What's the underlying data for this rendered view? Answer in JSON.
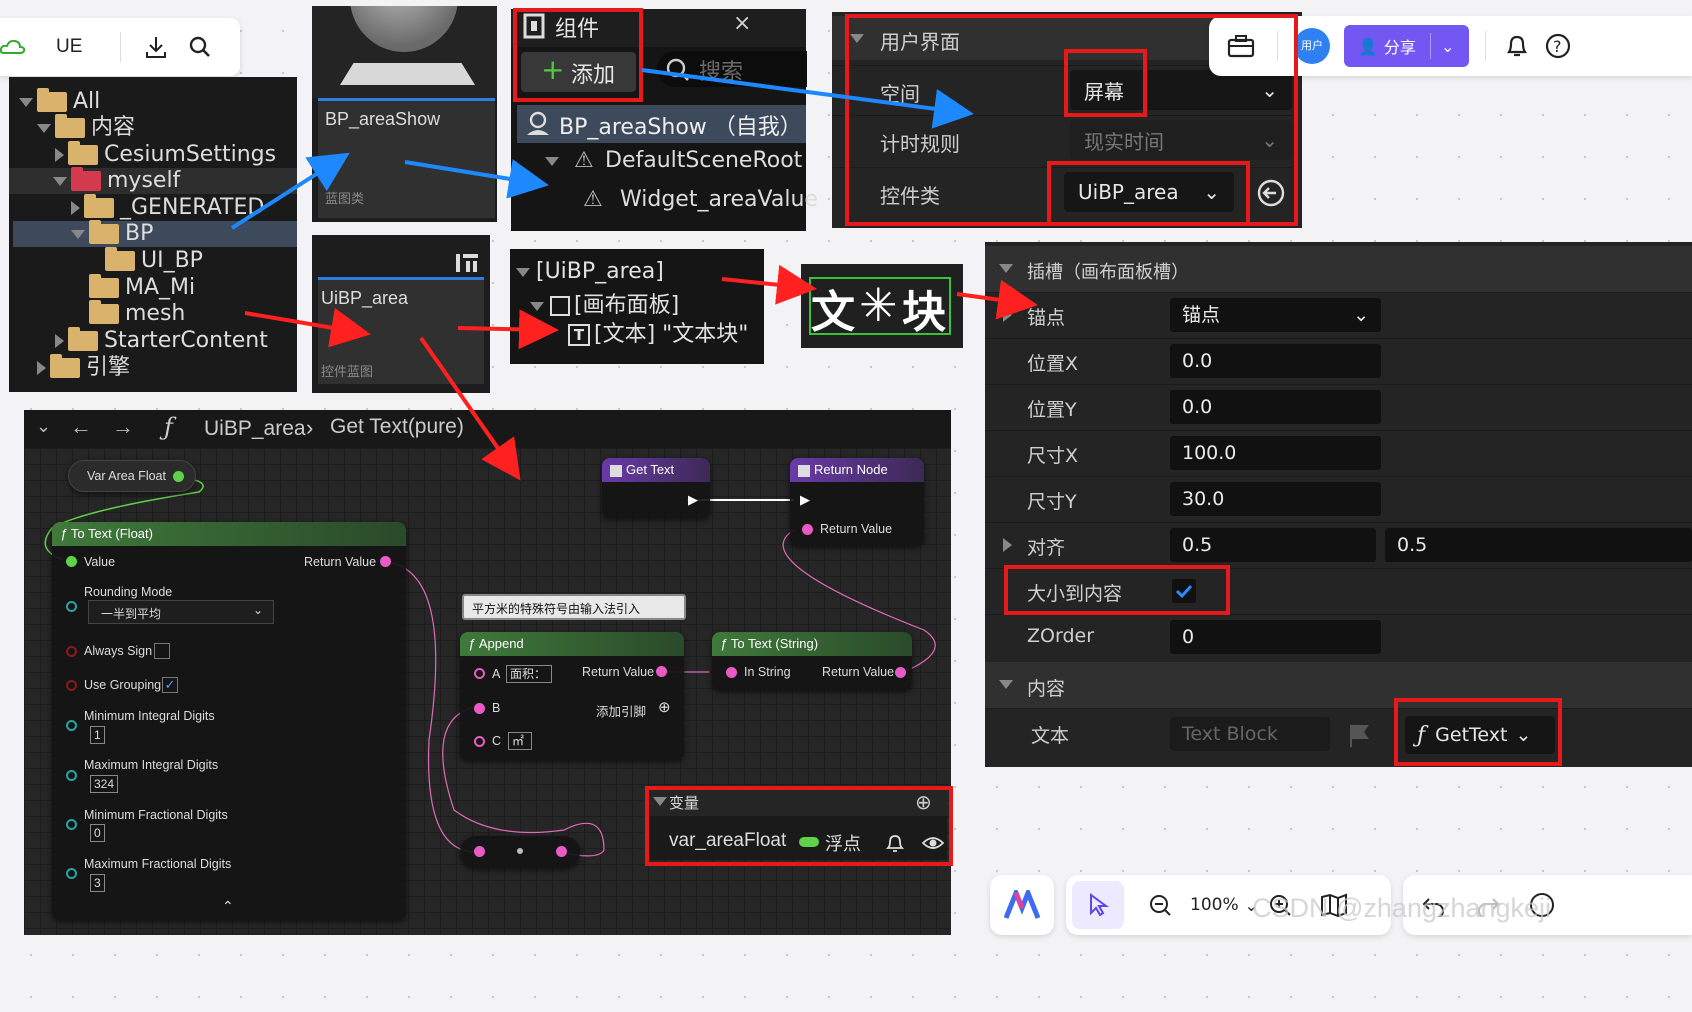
{
  "top_left_toolbar": {
    "ue_label": "UE"
  },
  "content_browser": {
    "items": [
      {
        "label": "All"
      },
      {
        "label": "内容"
      },
      {
        "label": "CesiumSettings"
      },
      {
        "label": "myself"
      },
      {
        "label": "_GENERATED"
      },
      {
        "label": "BP"
      },
      {
        "label": "UI_BP"
      },
      {
        "label": "MA_Mi"
      },
      {
        "label": "mesh"
      },
      {
        "label": "StarterContent"
      },
      {
        "label": "引擎"
      }
    ]
  },
  "asset_bp_areashow": {
    "name": "BP_areaShow",
    "type": "蓝图类"
  },
  "asset_uibp_area": {
    "name": "UiBP_area",
    "type": "控件蓝图"
  },
  "components_panel": {
    "title": "组件",
    "add_label": "添加",
    "search_placeholder": "搜索",
    "items": [
      "BP_areaShow （自我）",
      "DefaultSceneRoot",
      "Widget_areaValue"
    ]
  },
  "user_interface": {
    "title": "用户界面",
    "rows": [
      {
        "label": "空间",
        "value": "屏幕"
      },
      {
        "label": "计时规则",
        "value": "现实时间"
      },
      {
        "label": "控件类",
        "value": "UiBP_area"
      }
    ]
  },
  "top_right_toolbar": {
    "user_label": "用户",
    "share_label": "分享"
  },
  "hierarchy": {
    "root": "[UiBP_area]",
    "canvas": "[画布面板]",
    "text": "[文本] \"文本块\""
  },
  "text_preview": {
    "text_left": "文",
    "text_right": "块"
  },
  "details": {
    "slot_header": "插槽（画布面板槽）",
    "anchor_label": "锚点",
    "anchor_value": "锚点",
    "pos_x_label": "位置X",
    "pos_x_value": "0.0",
    "pos_y_label": "位置Y",
    "pos_y_value": "0.0",
    "size_x_label": "尺寸X",
    "size_x_value": "100.0",
    "size_y_label": "尺寸Y",
    "size_y_value": "30.0",
    "align_label": "对齐",
    "align_x": "0.5",
    "align_y": "0.5",
    "size_to_content_label": "大小到内容",
    "size_to_content_checked": true,
    "zorder_label": "ZOrder",
    "zorder_value": "0",
    "content_header": "内容",
    "text_label": "文本",
    "text_placeholder": "Text Block",
    "binding_label": "GetText"
  },
  "graph": {
    "breadcrumb_class": "UiBP_area",
    "breadcrumb_func": "Get Text(pure)",
    "var_node": "Var Area Float",
    "to_text_float": {
      "title": "To Text (Float)",
      "value_label": "Value",
      "return_label": "Return Value",
      "rounding_label": "Rounding Mode",
      "rounding_value": "一半到平均",
      "always_sign": "Always Sign",
      "use_grouping": "Use Grouping",
      "min_int_label": "Minimum Integral Digits",
      "min_int": "1",
      "max_int_label": "Maximum Integral Digits",
      "max_int": "324",
      "min_frac_label": "Minimum Fractional Digits",
      "min_frac": "0",
      "max_frac_label": "Maximum Fractional Digits",
      "max_frac": "3"
    },
    "get_text": "Get Text",
    "return_node": {
      "title": "Return Node",
      "pin": "Return Value"
    },
    "comment": "平方米的特殊符号由输入法引入",
    "append": {
      "title": "Append",
      "a": "A",
      "a_value": "面积：",
      "b": "B",
      "c": "C",
      "c_value": "㎡",
      "return": "Return Value",
      "add_pin": "添加引脚"
    },
    "to_text_string": {
      "title": "To Text (String)",
      "in": "In String",
      "return": "Return Value"
    }
  },
  "variables_panel": {
    "title": "变量",
    "var_name": "var_areaFloat",
    "var_type": "浮点"
  },
  "bottom_toolbar": {
    "zoom": "100%"
  },
  "watermark": "CSDN @zhangzhangkeji"
}
